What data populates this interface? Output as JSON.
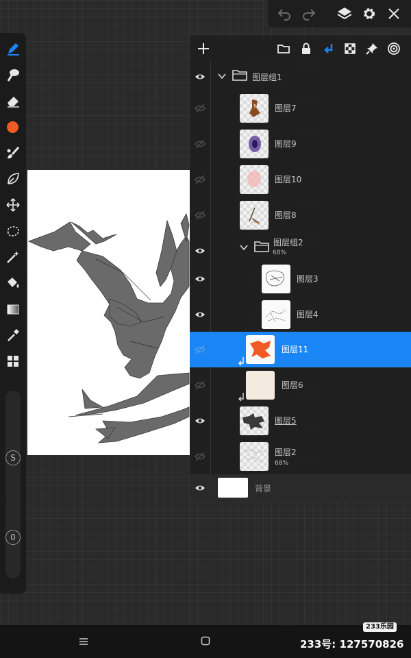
{
  "top_toolbar": {
    "icons": [
      "undo-icon",
      "redo-icon",
      "layers-icon",
      "gear-icon",
      "close-icon"
    ]
  },
  "left_toolbar": {
    "tools": [
      "pen-icon",
      "smudge-icon",
      "eraser-icon",
      "color-swatch",
      "brush-icon",
      "lasso-leaf-icon",
      "transform-icon",
      "selection-icon",
      "magic-wand-icon",
      "fill-bucket-icon",
      "gradient-icon",
      "eyedropper-icon",
      "grid-icon"
    ],
    "active_color": "#f05a24",
    "size_badge": "S",
    "opacity_badge": "0"
  },
  "layers_panel": {
    "header_icons": [
      "add-layer-icon",
      "folder-icon",
      "lock-icon",
      "clip-icon",
      "checker-icon",
      "pin-icon",
      "spiral-icon"
    ],
    "accent": "#1a86f5",
    "layers": [
      {
        "name": "图层组1",
        "type": "group",
        "visible": true,
        "expanded": true
      },
      {
        "name": "图层7",
        "type": "layer",
        "visible": false
      },
      {
        "name": "图层9",
        "type": "layer",
        "visible": false
      },
      {
        "name": "图层10",
        "type": "layer",
        "visible": false
      },
      {
        "name": "图层8",
        "type": "layer",
        "visible": false
      },
      {
        "name": "图层组2",
        "type": "group",
        "visible": true,
        "opacity": "68%"
      },
      {
        "name": "图层3",
        "type": "layer",
        "visible": true
      },
      {
        "name": "图层4",
        "type": "layer",
        "visible": true
      },
      {
        "name": "图层11",
        "type": "layer",
        "visible": false,
        "selected": true
      },
      {
        "name": "图层6",
        "type": "layer",
        "visible": false
      },
      {
        "name": "图层5",
        "type": "layer",
        "visible": true
      },
      {
        "name": "图层2",
        "type": "layer",
        "visible": false,
        "opacity": "68%"
      }
    ],
    "background": {
      "name": "背景",
      "visible": true
    }
  },
  "bottom_bar": {
    "watermark_badge": "233乐园",
    "watermark_text": "233号: 127570826"
  }
}
